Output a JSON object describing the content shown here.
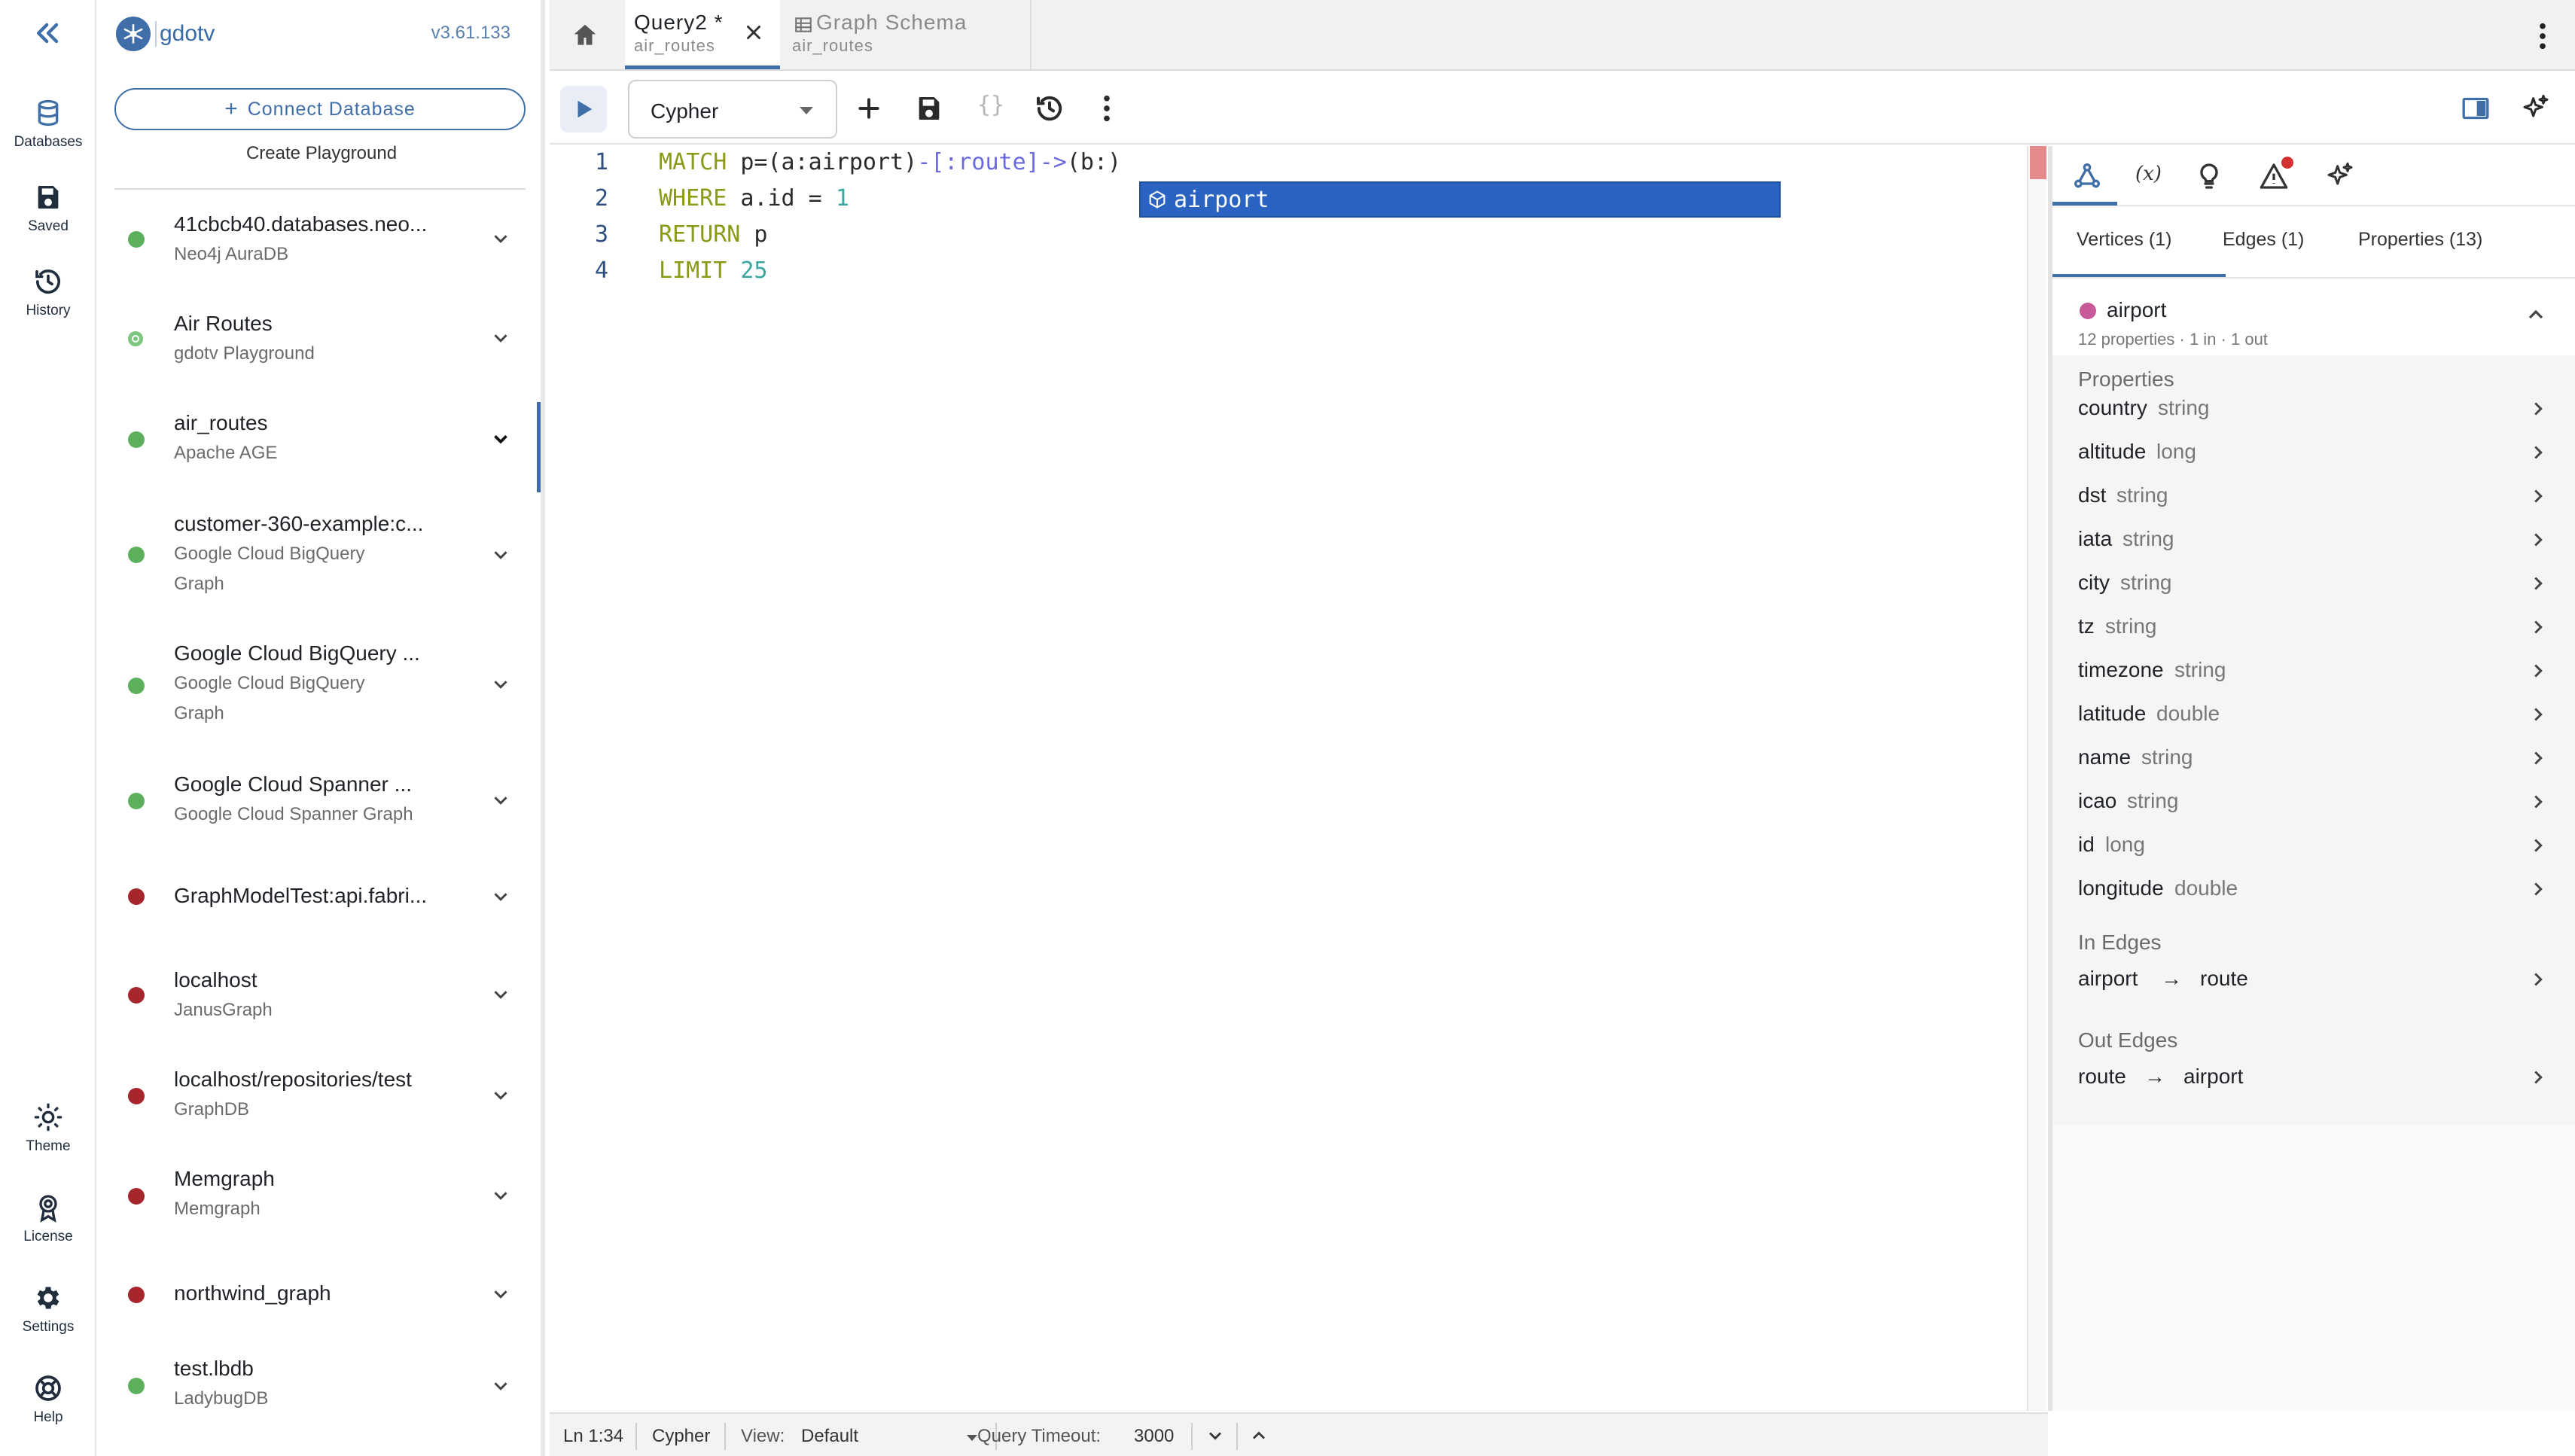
{
  "rail": {
    "collapse_icon": "double-chevron-left-icon",
    "items": [
      {
        "label": "Databases",
        "icon": "database-icon"
      },
      {
        "label": "Saved",
        "icon": "save-icon"
      },
      {
        "label": "History",
        "icon": "history-icon"
      }
    ],
    "bottom_items": [
      {
        "label": "Theme",
        "icon": "sun-icon"
      },
      {
        "label": "License",
        "icon": "license-icon"
      },
      {
        "label": "Settings",
        "icon": "gear-icon"
      },
      {
        "label": "Help",
        "icon": "lifebuoy-icon"
      }
    ]
  },
  "sidebar": {
    "brand": "gdotv",
    "version": "v3.61.133",
    "connect_label": "Connect Database",
    "playground_label": "Create Playground",
    "databases": [
      {
        "title": "41cbcb40.databases.neo...",
        "sub": [
          "Neo4j AuraDB"
        ],
        "status": "green"
      },
      {
        "title": "Air Routes",
        "sub": [
          "gdotv Playground"
        ],
        "status": "ring"
      },
      {
        "title": "air_routes",
        "sub": [
          "Apache AGE"
        ],
        "status": "green",
        "expanded": true
      },
      {
        "title": "customer-360-example:c...",
        "sub": [
          "Google Cloud BigQuery",
          "Graph"
        ],
        "status": "green"
      },
      {
        "title": "Google Cloud BigQuery ...",
        "sub": [
          "Google Cloud BigQuery",
          "Graph"
        ],
        "status": "green"
      },
      {
        "title": "Google Cloud Spanner ...",
        "sub": [
          "Google Cloud Spanner Graph"
        ],
        "status": "green"
      },
      {
        "title": "GraphModelTest:api.fabri...",
        "sub": [],
        "status": "red"
      },
      {
        "title": "localhost",
        "sub": [
          "JanusGraph"
        ],
        "status": "red"
      },
      {
        "title": "localhost/repositories/test",
        "sub": [
          "GraphDB"
        ],
        "status": "red"
      },
      {
        "title": "Memgraph",
        "sub": [
          "Memgraph"
        ],
        "status": "red"
      },
      {
        "title": "northwind_graph",
        "sub": [],
        "status": "red"
      },
      {
        "title": "test.lbdb",
        "sub": [
          "LadybugDB"
        ],
        "status": "green"
      }
    ]
  },
  "tabs": [
    {
      "title": "Query2 *",
      "sub": "air_routes",
      "active": true
    },
    {
      "title": "Graph Schema",
      "sub": "air_routes",
      "active": false,
      "icon": "table-icon"
    }
  ],
  "toolbar": {
    "language": "Cypher",
    "format_glyph": "{}"
  },
  "editor": {
    "lines": [
      {
        "n": "1"
      },
      {
        "n": "2"
      },
      {
        "n": "3"
      },
      {
        "n": "4"
      }
    ],
    "code": {
      "l1_kw": "MATCH",
      "l1_rest": " p=",
      "l1_a": "(a:airport)",
      "l1_dash": "-",
      "l1_rel": "[:route]",
      "l1_arrow": "->",
      "l1_b": "(b:)",
      "l2_kw": "WHERE",
      "l2_rest": " a.id = ",
      "l2_num": "1",
      "l3_kw": "RETURN",
      "l3_rest": " p",
      "l4_kw": "LIMIT",
      "l4_num": "25"
    },
    "suggestion": "airport"
  },
  "right_panel": {
    "subtabs": [
      "Vertices (1)",
      "Edges (1)",
      "Properties (13)"
    ],
    "vertex": {
      "name": "airport",
      "meta": "12 properties · 1 in · 1 out",
      "color": "#c85a9a"
    },
    "properties_heading": "Properties",
    "properties": [
      {
        "name": "country",
        "type": "string"
      },
      {
        "name": "altitude",
        "type": "long"
      },
      {
        "name": "dst",
        "type": "string"
      },
      {
        "name": "iata",
        "type": "string"
      },
      {
        "name": "city",
        "type": "string"
      },
      {
        "name": "tz",
        "type": "string"
      },
      {
        "name": "timezone",
        "type": "string"
      },
      {
        "name": "latitude",
        "type": "double"
      },
      {
        "name": "name",
        "type": "string"
      },
      {
        "name": "icao",
        "type": "string"
      },
      {
        "name": "id",
        "type": "long"
      },
      {
        "name": "longitude",
        "type": "double"
      }
    ],
    "in_edges_heading": "In Edges",
    "in_edges": [
      {
        "from": "airport",
        "arrow": "→",
        "to": "route"
      }
    ],
    "out_edges_heading": "Out Edges",
    "out_edges": [
      {
        "from": "route",
        "arrow": "→",
        "to": "airport"
      }
    ]
  },
  "statusbar": {
    "position": "Ln 1:34",
    "language": "Cypher",
    "view_label": "View:",
    "view_value": "Default",
    "timeout_label": "Query Timeout:",
    "timeout_value": "3000"
  },
  "colors": {
    "accent": "#3f6ea8",
    "status_green": "#5cb05c",
    "status_red": "#a5262b",
    "suggestion_bg": "#2a63c1"
  }
}
